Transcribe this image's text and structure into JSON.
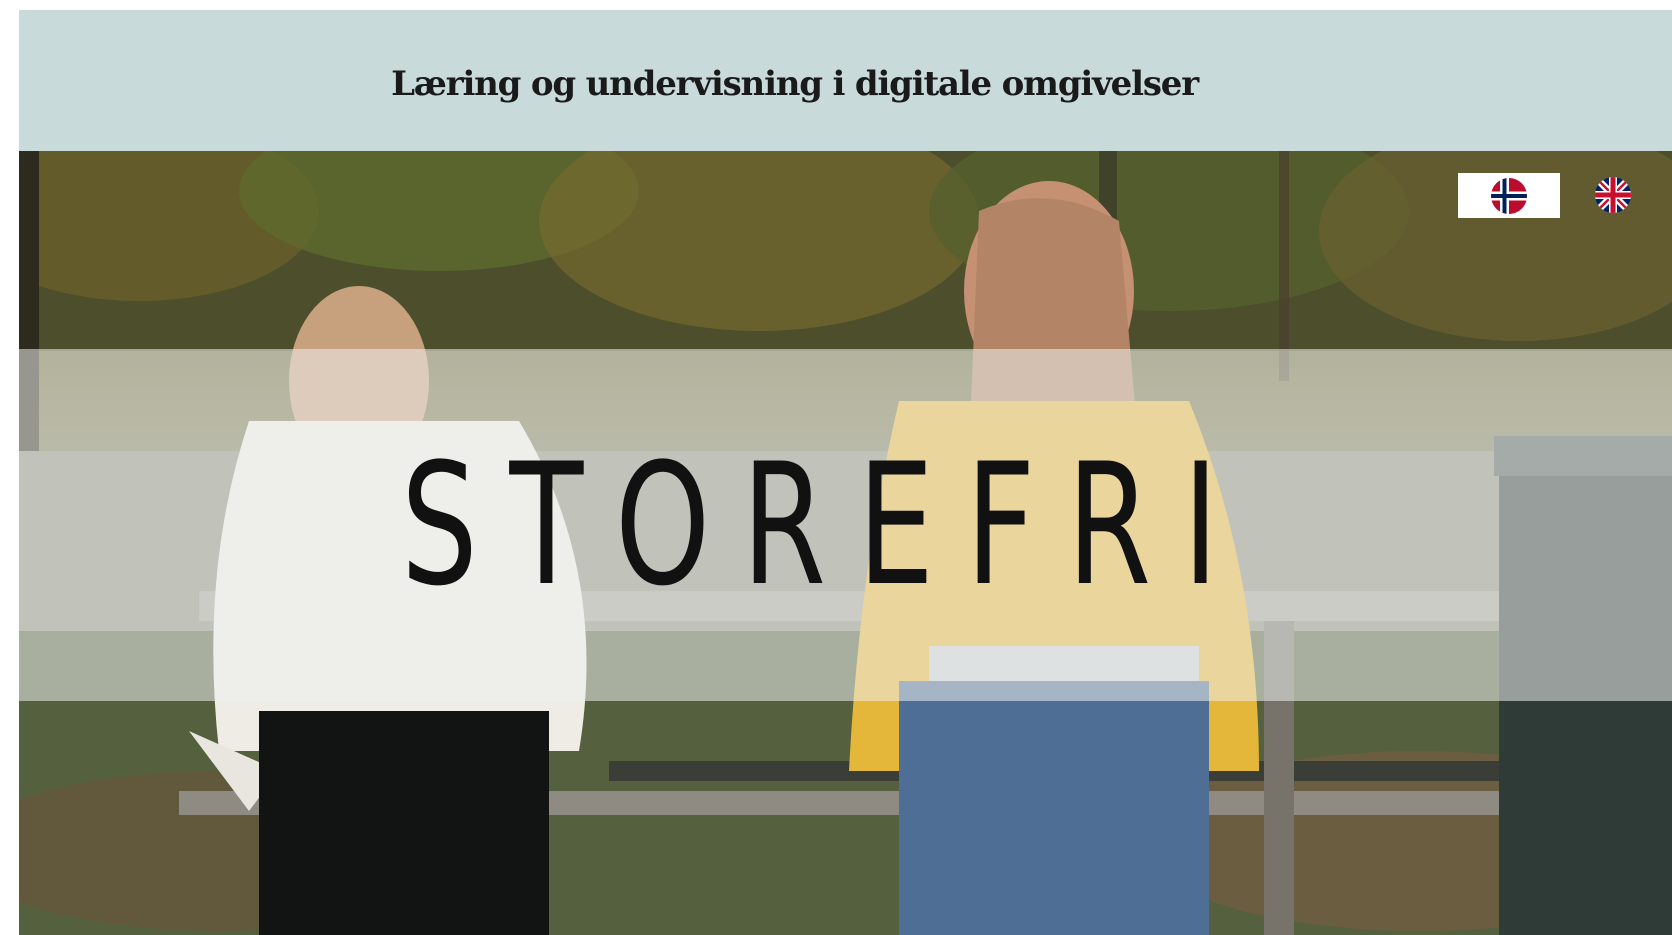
{
  "header": {
    "title": "Læring og undervisning i digitale omgivelser"
  },
  "hero": {
    "title": "STOREFRI"
  },
  "language_switcher": {
    "options": [
      {
        "icon": "norway-flag-icon",
        "selected": true
      },
      {
        "icon": "uk-flag-icon",
        "selected": false
      }
    ]
  },
  "colors": {
    "header_background": "#c9dada",
    "band_overlay": "#eef0ee",
    "title_text": "#111111"
  }
}
